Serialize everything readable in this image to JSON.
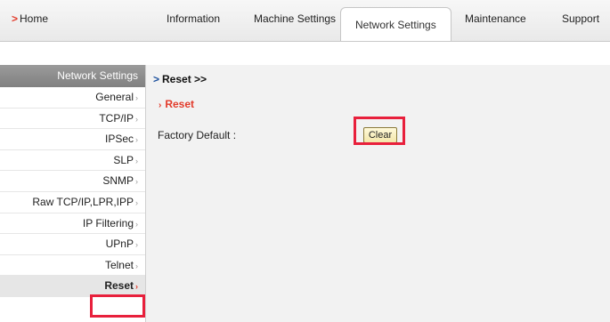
{
  "header": {
    "home_label": "Home",
    "tabs": [
      {
        "label": "Information"
      },
      {
        "label": "Machine Settings"
      },
      {
        "label": "Network Settings"
      },
      {
        "label": "Maintenance"
      },
      {
        "label": "Support"
      }
    ]
  },
  "sidebar": {
    "heading": "Network Settings",
    "items": [
      {
        "label": "General"
      },
      {
        "label": "TCP/IP"
      },
      {
        "label": "IPSec"
      },
      {
        "label": "SLP"
      },
      {
        "label": "SNMP"
      },
      {
        "label": "Raw TCP/IP,LPR,IPP"
      },
      {
        "label": "IP Filtering"
      },
      {
        "label": "UPnP"
      },
      {
        "label": "Telnet"
      },
      {
        "label": "Reset"
      }
    ],
    "selected": "Reset"
  },
  "main": {
    "breadcrumb": "Reset >>",
    "section_title": "Reset",
    "factory_default_label": "Factory Default :",
    "clear_button_label": "Clear"
  },
  "colors": {
    "accent_red": "#e23a2a",
    "highlight_box": "#e8203c",
    "sidebar_header": "#8c8c8c"
  }
}
